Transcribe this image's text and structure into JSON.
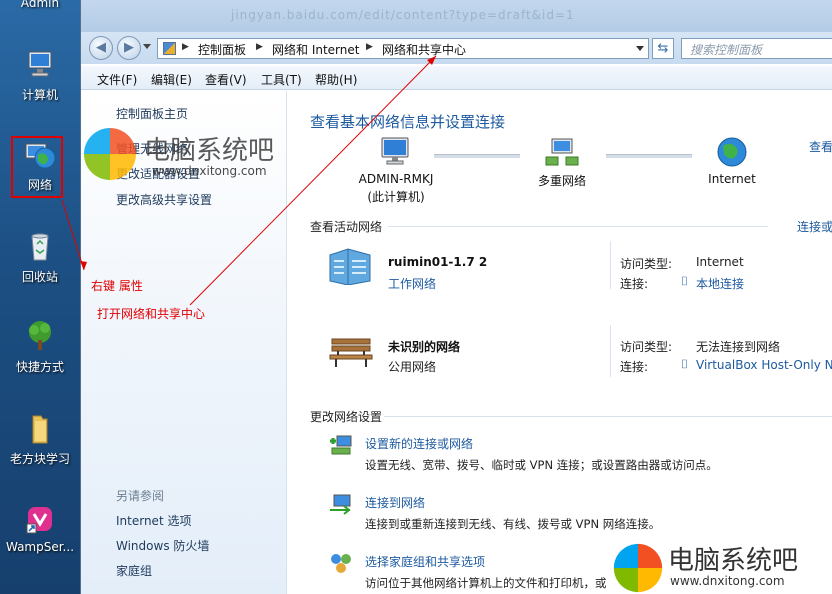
{
  "desktop": {
    "top_label": "Admin",
    "icons": [
      {
        "label": "计算机",
        "icon": "computer-icon"
      },
      {
        "label": "网络",
        "icon": "network-globe-icon"
      },
      {
        "label": "回收站",
        "icon": "recycle-bin-icon"
      },
      {
        "label": "快捷方式",
        "icon": "tree-shortcut-icon"
      },
      {
        "label": "老方块学习",
        "icon": "folder-icon"
      },
      {
        "label": "WampSer...",
        "icon": "wampserver-icon"
      }
    ]
  },
  "window": {
    "faded_title": "jingyan.baidu.com/edit/content?type=draft&id=1",
    "address_bar": {
      "crumbs": [
        "控制面板",
        "网络和 Internet",
        "网络和共享中心"
      ],
      "search_placeholder": "搜索控制面板"
    },
    "menu": [
      "文件(F)",
      "编辑(E)",
      "查看(V)",
      "工具(T)",
      "帮助(H)"
    ]
  },
  "left_pane": {
    "links": [
      "控制面板主页",
      "管理无线网络",
      "更改适配器设置",
      "更改高级共享设置"
    ],
    "see_also_heading": "另请参阅",
    "see_also": [
      "Internet 选项",
      "Windows 防火墙",
      "家庭组"
    ]
  },
  "main": {
    "title": "查看基本网络信息并设置连接",
    "right_link_top": "查看",
    "network_map": {
      "computer_name": "ADMIN-RMKJ",
      "computer_sub": "(此计算机)",
      "middle": "多重网络",
      "right": "Internet"
    },
    "active_networks_label": "查看活动网络",
    "active_networks_right_link": "连接或",
    "networks": [
      {
        "name": "ruimin01-1.7  2",
        "type": "工作网络",
        "access_label": "访问类型:",
        "access_value": "Internet",
        "conn_label": "连接:",
        "conn_value": "本地连接",
        "icon": "office-building-icon"
      },
      {
        "name": "未识别的网络",
        "type": "公用网络",
        "access_label": "访问类型:",
        "access_value": "无法连接到网络",
        "conn_label": "连接:",
        "conn_value": "VirtualBox Host-Only N",
        "icon": "park-bench-icon"
      }
    ],
    "change_settings_label": "更改网络设置",
    "tasks": [
      {
        "link": "设置新的连接或网络",
        "desc": "设置无线、宽带、拨号、临时或 VPN 连接；或设置路由器或访问点。"
      },
      {
        "link": "连接到网络",
        "desc": "连接到或重新连接到无线、有线、拨号或 VPN 网络连接。"
      },
      {
        "link": "选择家庭组和共享选项",
        "desc": "访问位于其他网络计算机上的文件和打印机，或"
      }
    ]
  },
  "annotations": {
    "right_click": "右键  属性",
    "open_center": "打开网络和共享中心"
  },
  "watermarks": {
    "top_text": "电脑系统吧",
    "top_url": "www.dnxitong.com",
    "bottom_text": "电脑系统吧",
    "bottom_url": "www.dnxitong.com"
  },
  "colors": {
    "annotation_red": "#e00000",
    "link_blue": "#1d5aa0",
    "desktop_blue": "#1e4f82"
  }
}
